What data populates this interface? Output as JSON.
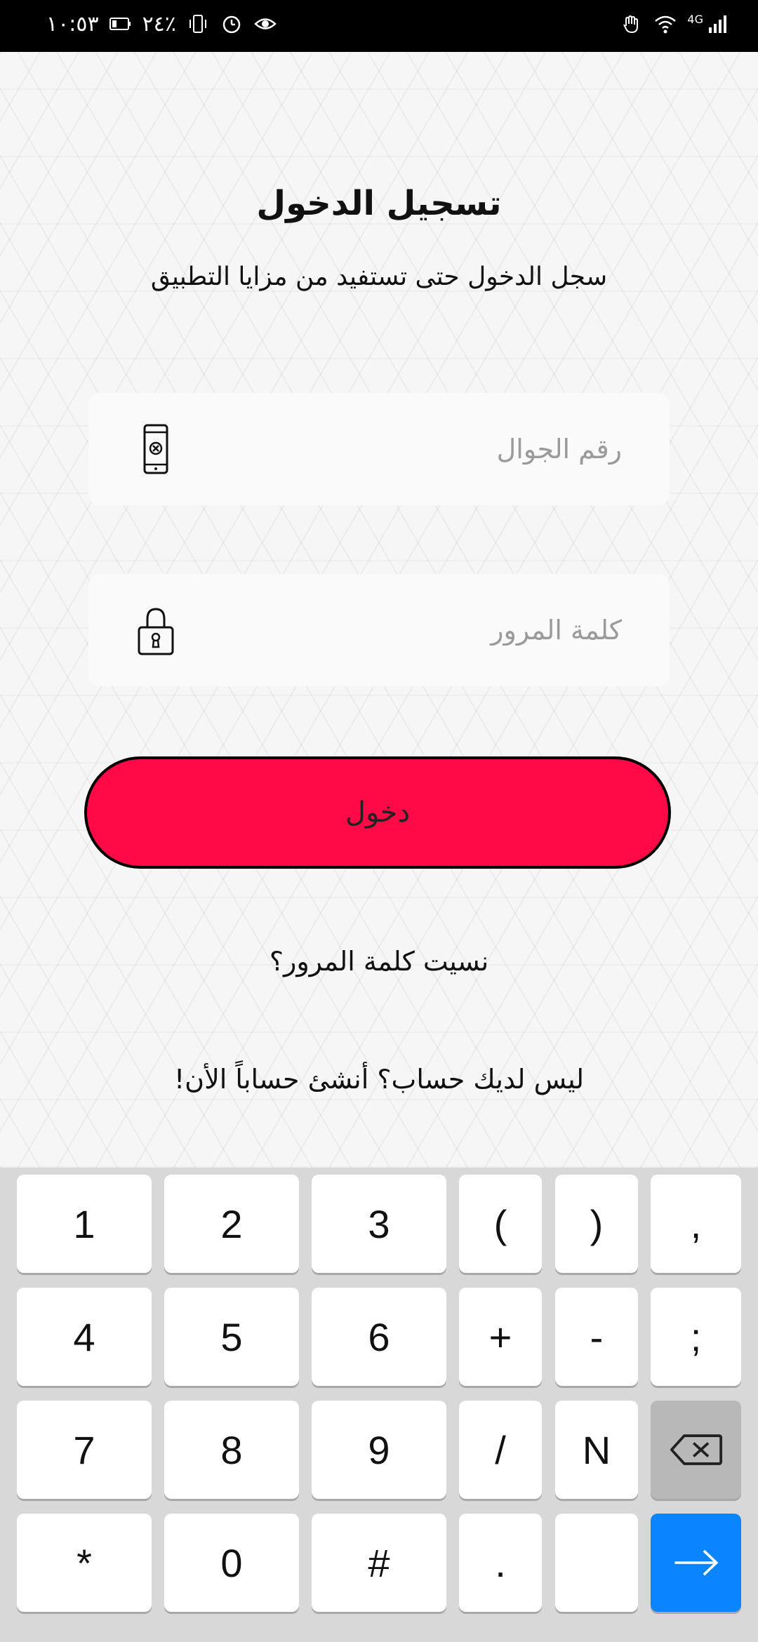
{
  "status_bar": {
    "time": "١٠:٥٣",
    "battery": "٢٤٪",
    "network": "4G",
    "icons": [
      "battery-icon",
      "vibrate-icon",
      "alarm-icon",
      "eye-icon",
      "hand-icon",
      "wifi-icon",
      "signal-icon"
    ]
  },
  "login": {
    "title": "تسجيل الدخول",
    "subtitle": "سجل الدخول حتى تستفيد من مزايا التطبيق",
    "phone_placeholder": "رقم الجوال",
    "phone_icon": "mobile-phone-icon",
    "password_placeholder": "كلمة المرور",
    "password_icon": "lock-icon",
    "login_button": "دخول",
    "forgot_password": "نسيت كلمة المرور؟",
    "signup_prompt": "ليس لديك حساب؟ أنشئ حساباً الأن!"
  },
  "keyboard": {
    "rows": [
      [
        "1",
        "2",
        "3",
        "(",
        ")",
        ","
      ],
      [
        "4",
        "5",
        "6",
        "+",
        "-",
        ";"
      ],
      [
        "7",
        "8",
        "9",
        "/",
        "N",
        "backspace"
      ],
      [
        "*",
        "0",
        "#",
        ".",
        "",
        "enter"
      ]
    ]
  },
  "colors": {
    "accent": "#ff0a46",
    "enter_key": "#0a84ff",
    "keyboard_bg": "#d8d8d8"
  }
}
